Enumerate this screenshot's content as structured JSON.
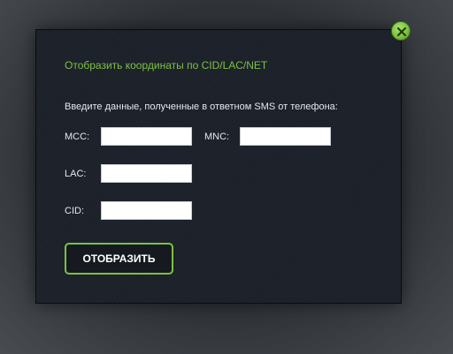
{
  "dialog": {
    "title": "Отобразить координаты по CID/LAC/NET",
    "instructions": "Введите данные, полученные в ответном SMS от телефона:",
    "fields": {
      "mcc": {
        "label": "MCC:",
        "value": ""
      },
      "mnc": {
        "label": "MNC:",
        "value": ""
      },
      "lac": {
        "label": "LAC:",
        "value": ""
      },
      "cid": {
        "label": "CID:",
        "value": ""
      }
    },
    "submit_label": "ОТОБРАЗИТЬ",
    "close_icon": "close-icon"
  },
  "colors": {
    "accent": "#7cc242",
    "dialog_background": "#1b2029",
    "overlay": "#2f3338"
  }
}
